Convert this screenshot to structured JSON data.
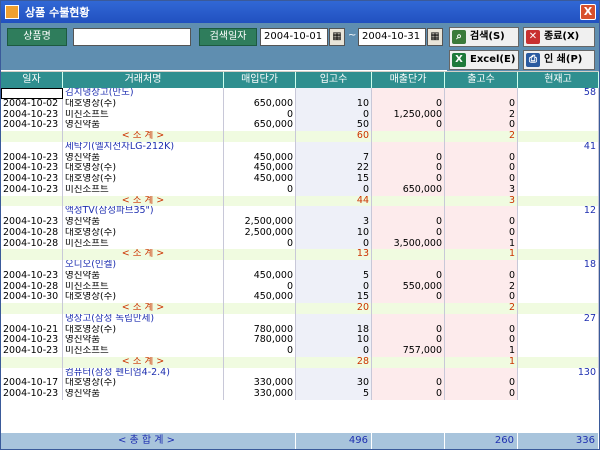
{
  "window": {
    "title": "상품 수불현황",
    "close": "X"
  },
  "toolbar": {
    "product_label": "상품명",
    "product_value": "",
    "date_label": "검색일자",
    "date_from": "2004-10-01",
    "date_to": "2004-10-31",
    "tilde": "~",
    "search_label": "검색(S)",
    "close_label": "종료(X)",
    "excel_label": "Excel(E)",
    "print_label": "인 쇄(P)"
  },
  "columns": [
    "일자",
    "거래처명",
    "매입단가",
    "입고수",
    "매출단가",
    "출고수",
    "현재고"
  ],
  "rows": [
    {
      "t": "grp",
      "d": "",
      "n": "김치냉장고(만도)",
      "a": "",
      "b": "",
      "c": "",
      "e": "",
      "s": "58",
      "sel": true
    },
    {
      "t": "r",
      "d": "2004-10-02",
      "n": "대호영상(주)",
      "a": "650,000",
      "b": "10",
      "c": "0",
      "e": "0",
      "s": ""
    },
    {
      "t": "r",
      "d": "2004-10-23",
      "n": "미진소프트",
      "a": "0",
      "b": "0",
      "c": "1,250,000",
      "e": "2",
      "s": ""
    },
    {
      "t": "r",
      "d": "2004-10-23",
      "n": "영진약품",
      "a": "650,000",
      "b": "50",
      "c": "0",
      "e": "0",
      "s": ""
    },
    {
      "t": "sub",
      "d": "",
      "n": "< 소   계 >",
      "a": "",
      "b": "60",
      "c": "",
      "e": "2",
      "s": ""
    },
    {
      "t": "grp",
      "d": "",
      "n": "세탁기(엘지전자LG-212K)",
      "a": "",
      "b": "",
      "c": "",
      "e": "",
      "s": "41"
    },
    {
      "t": "r",
      "d": "2004-10-23",
      "n": "영진약품",
      "a": "450,000",
      "b": "7",
      "c": "0",
      "e": "0",
      "s": ""
    },
    {
      "t": "r",
      "d": "2004-10-23",
      "n": "대호영상(주)",
      "a": "450,000",
      "b": "22",
      "c": "0",
      "e": "0",
      "s": ""
    },
    {
      "t": "r",
      "d": "2004-10-23",
      "n": "대호영상(주)",
      "a": "450,000",
      "b": "15",
      "c": "0",
      "e": "0",
      "s": ""
    },
    {
      "t": "r",
      "d": "2004-10-23",
      "n": "미진소프트",
      "a": "0",
      "b": "0",
      "c": "650,000",
      "e": "3",
      "s": ""
    },
    {
      "t": "sub",
      "d": "",
      "n": "< 소   계 >",
      "a": "",
      "b": "44",
      "c": "",
      "e": "3",
      "s": ""
    },
    {
      "t": "grp",
      "d": "",
      "n": "액정TV(삼성파브35\")",
      "a": "",
      "b": "",
      "c": "",
      "e": "",
      "s": "12"
    },
    {
      "t": "r",
      "d": "2004-10-23",
      "n": "영진약품",
      "a": "2,500,000",
      "b": "3",
      "c": "0",
      "e": "0",
      "s": ""
    },
    {
      "t": "r",
      "d": "2004-10-28",
      "n": "대호영상(주)",
      "a": "2,500,000",
      "b": "10",
      "c": "0",
      "e": "0",
      "s": ""
    },
    {
      "t": "r",
      "d": "2004-10-28",
      "n": "미진소프트",
      "a": "0",
      "b": "0",
      "c": "3,500,000",
      "e": "1",
      "s": ""
    },
    {
      "t": "sub",
      "d": "",
      "n": "< 소   계 >",
      "a": "",
      "b": "13",
      "c": "",
      "e": "1",
      "s": ""
    },
    {
      "t": "grp",
      "d": "",
      "n": "오디오(인켈)",
      "a": "",
      "b": "",
      "c": "",
      "e": "",
      "s": "18"
    },
    {
      "t": "r",
      "d": "2004-10-23",
      "n": "영진약품",
      "a": "450,000",
      "b": "5",
      "c": "0",
      "e": "0",
      "s": ""
    },
    {
      "t": "r",
      "d": "2004-10-28",
      "n": "미진소프트",
      "a": "0",
      "b": "0",
      "c": "550,000",
      "e": "2",
      "s": ""
    },
    {
      "t": "r",
      "d": "2004-10-30",
      "n": "대호영상(주)",
      "a": "450,000",
      "b": "15",
      "c": "0",
      "e": "0",
      "s": ""
    },
    {
      "t": "sub",
      "d": "",
      "n": "< 소   계 >",
      "a": "",
      "b": "20",
      "c": "",
      "e": "2",
      "s": ""
    },
    {
      "t": "grp",
      "d": "",
      "n": "냉장고(삼성 독립만세)",
      "a": "",
      "b": "",
      "c": "",
      "e": "",
      "s": "27"
    },
    {
      "t": "r",
      "d": "2004-10-21",
      "n": "대호영상(주)",
      "a": "780,000",
      "b": "18",
      "c": "0",
      "e": "0",
      "s": ""
    },
    {
      "t": "r",
      "d": "2004-10-23",
      "n": "영진약품",
      "a": "780,000",
      "b": "10",
      "c": "0",
      "e": "0",
      "s": ""
    },
    {
      "t": "r",
      "d": "2004-10-23",
      "n": "미진소프트",
      "a": "0",
      "b": "0",
      "c": "757,000",
      "e": "1",
      "s": ""
    },
    {
      "t": "sub",
      "d": "",
      "n": "< 소   계 >",
      "a": "",
      "b": "28",
      "c": "",
      "e": "1",
      "s": ""
    },
    {
      "t": "grp",
      "d": "",
      "n": "컴퓨터(삼성 펜티엄4-2.4)",
      "a": "",
      "b": "",
      "c": "",
      "e": "",
      "s": "130"
    },
    {
      "t": "r",
      "d": "2004-10-17",
      "n": "대호영상(주)",
      "a": "330,000",
      "b": "30",
      "c": "0",
      "e": "0",
      "s": ""
    },
    {
      "t": "r",
      "d": "2004-10-23",
      "n": "영진약품",
      "a": "330,000",
      "b": "5",
      "c": "0",
      "e": "0",
      "s": ""
    }
  ],
  "footer": {
    "label": "< 총     합     계 >",
    "in_total": "496",
    "out_total": "260",
    "stock_total": "336"
  }
}
